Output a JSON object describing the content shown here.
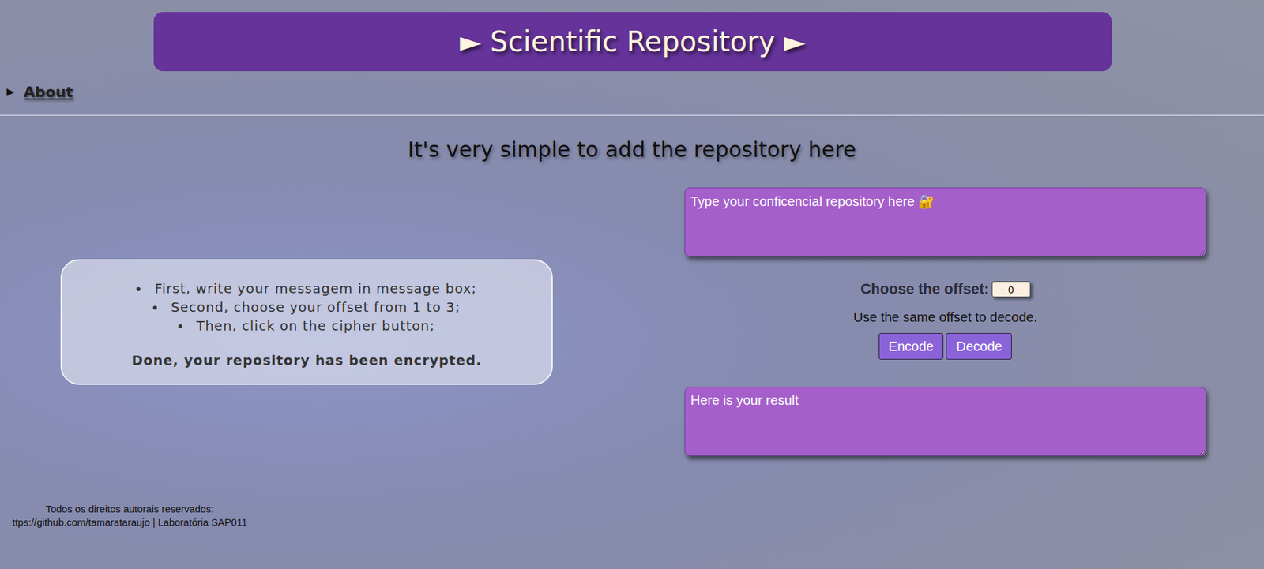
{
  "window": {
    "title": "► Scientific Repository ►"
  },
  "about": {
    "marker": "▶",
    "label": "About",
    "expanded": false
  },
  "heading": "It's very simple to add the repository here",
  "instructions": {
    "steps": [
      "First, write your messagem in message box;",
      "Second, choose your offset from 1 to 3;",
      "Then, click on the cipher button;"
    ],
    "done": "Done, your repository has been encrypted."
  },
  "message_box": {
    "placeholder": "Type your conficencial repository here 🔐"
  },
  "offset": {
    "label": "Choose the offset:",
    "value": "0"
  },
  "note": "Use the same offset to decode.",
  "buttons": [
    "Encode",
    "Decode"
  ],
  "result_box": {
    "placeholder": "Here is your result"
  },
  "footer": [
    "Todos os direitos autorais reservados:",
    "ttps://github.com/tamarataraujo | Laboratória SAP011"
  ]
}
